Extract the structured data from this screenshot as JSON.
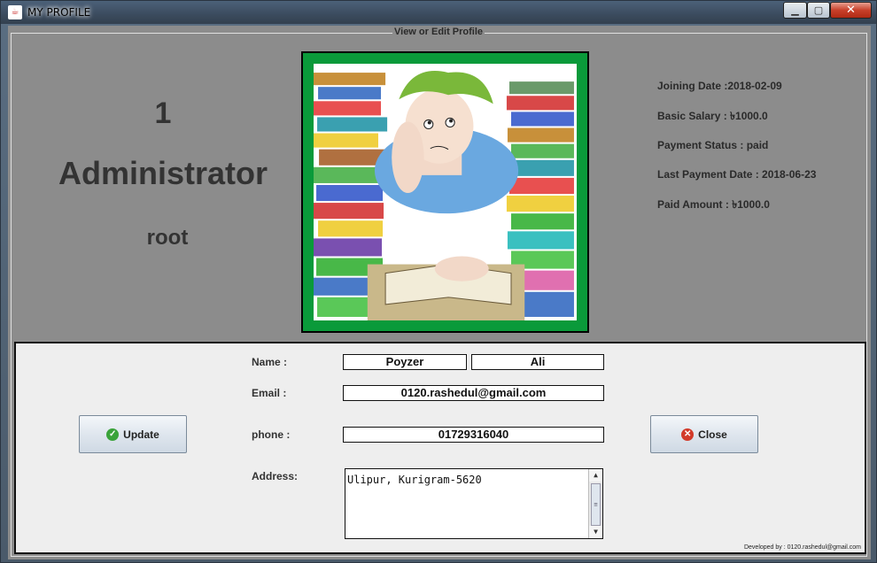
{
  "window": {
    "title": "MY PROFILE"
  },
  "group": {
    "title": "View or Edit Profile"
  },
  "profile": {
    "id": "1",
    "role": "Administrator",
    "username": "root"
  },
  "info": {
    "joining": "Joining Date :2018-02-09",
    "salary": "Basic Salary : ৳1000.0",
    "payment_status": "Payment Status : paid",
    "last_payment": "Last Payment Date : 2018-06-23",
    "paid_amount": "Paid Amount : ৳1000.0"
  },
  "form": {
    "name_label": "Name :",
    "first_name": "Poyzer",
    "last_name": "Ali",
    "email_label": "Email :",
    "email": "0120.rashedul@gmail.com",
    "phone_label": "phone :",
    "phone": "01729316040",
    "address_label": "Address:",
    "address": "Ulipur, Kurigram-5620"
  },
  "buttons": {
    "update": "Update",
    "close": "Close"
  },
  "footer": "Developed by : 0120.rashedul@gmail.com",
  "icons": [
    "java-icon",
    "minimize-icon",
    "maximize-icon",
    "close-icon",
    "check-icon",
    "cancel-icon"
  ]
}
